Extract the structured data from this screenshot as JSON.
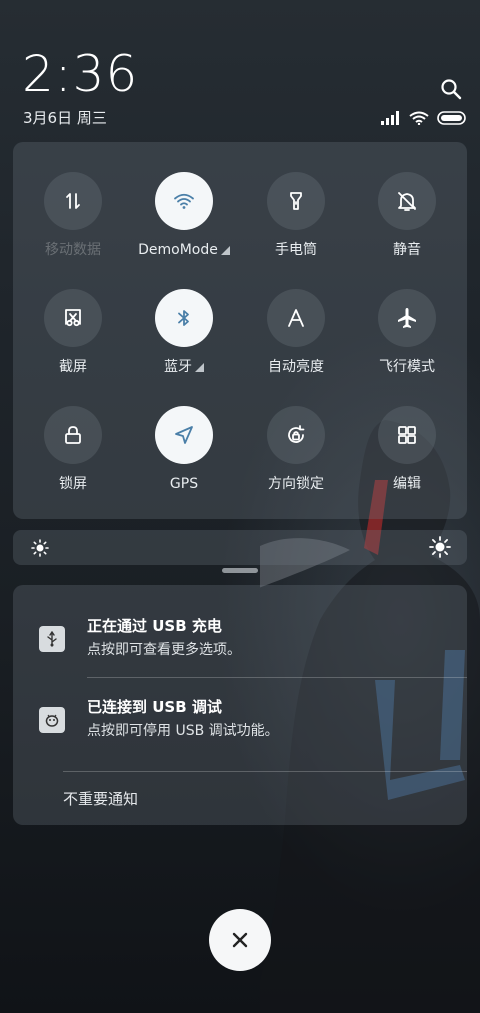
{
  "header": {
    "time": "2:36",
    "date": "3月6日 周三"
  },
  "quick_settings": [
    {
      "id": "mobile-data",
      "label": "移动数据",
      "icon": "mobile-data-icon",
      "active": false,
      "dim": true,
      "has_arrow": false
    },
    {
      "id": "wifi",
      "label": "DemoMode",
      "icon": "wifi-icon",
      "active": true,
      "dim": false,
      "has_arrow": true
    },
    {
      "id": "flashlight",
      "label": "手电筒",
      "icon": "flashlight-icon",
      "active": false,
      "dim": false,
      "has_arrow": false
    },
    {
      "id": "mute",
      "label": "静音",
      "icon": "bell-off-icon",
      "active": false,
      "dim": false,
      "has_arrow": false
    },
    {
      "id": "screenshot",
      "label": "截屏",
      "icon": "screenshot-icon",
      "active": false,
      "dim": false,
      "has_arrow": false
    },
    {
      "id": "bluetooth",
      "label": "蓝牙",
      "icon": "bluetooth-icon",
      "active": true,
      "dim": false,
      "has_arrow": true
    },
    {
      "id": "auto-brightness",
      "label": "自动亮度",
      "icon": "auto-brightness-icon",
      "active": false,
      "dim": false,
      "has_arrow": false
    },
    {
      "id": "airplane",
      "label": "飞行模式",
      "icon": "airplane-icon",
      "active": false,
      "dim": false,
      "has_arrow": false
    },
    {
      "id": "lock",
      "label": "锁屏",
      "icon": "lock-icon",
      "active": false,
      "dim": false,
      "has_arrow": false
    },
    {
      "id": "gps",
      "label": "GPS",
      "icon": "gps-icon",
      "active": true,
      "dim": false,
      "has_arrow": false
    },
    {
      "id": "rotation-lock",
      "label": "方向锁定",
      "icon": "rotation-lock-icon",
      "active": false,
      "dim": false,
      "has_arrow": false
    },
    {
      "id": "edit",
      "label": "编辑",
      "icon": "grid-icon",
      "active": false,
      "dim": false,
      "has_arrow": false
    }
  ],
  "notifications": [
    {
      "title": "正在通过 USB 充电",
      "body": "点按即可查看更多选项。",
      "icon": "usb-icon"
    },
    {
      "title": "已连接到 USB 调试",
      "body": "点按即可停用 USB 调试功能。",
      "icon": "android-debug-icon"
    }
  ],
  "unimportant_label": "不重要通知",
  "colors": {
    "active_tile": "#f4f7f9",
    "active_icon": "#4a7fa8",
    "panel": "rgba(110,120,130,0.30)"
  }
}
